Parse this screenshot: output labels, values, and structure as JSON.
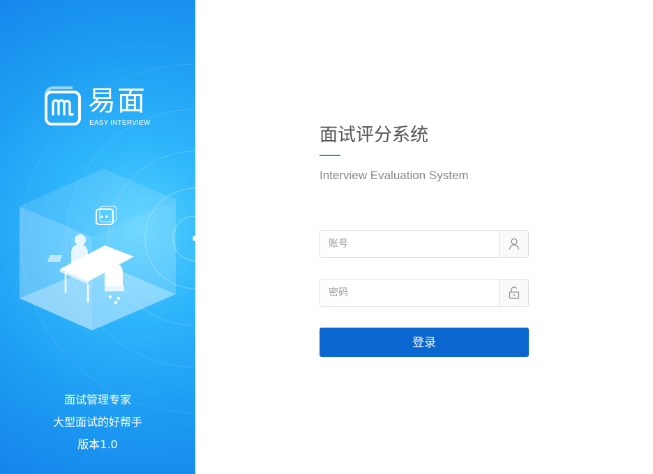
{
  "sidebar": {
    "logo": {
      "name": "易面",
      "subtitle": "EASY INTERVIEW"
    },
    "taglines": [
      "面试管理专家",
      "大型面试的好帮手",
      "版本1.0"
    ]
  },
  "main": {
    "title": "面试评分系统",
    "subtitle": "Interview Evaluation System"
  },
  "login_form": {
    "account": {
      "placeholder": "账号",
      "value": "",
      "icon": "user-icon"
    },
    "password": {
      "placeholder": "密码",
      "value": "",
      "icon": "lock-icon"
    },
    "submit_label": "登录"
  },
  "colors": {
    "accent": "#1a8fe3",
    "button": "#0c66cf",
    "panel_light": "#53d0ff",
    "panel_dark": "#1485ec"
  }
}
